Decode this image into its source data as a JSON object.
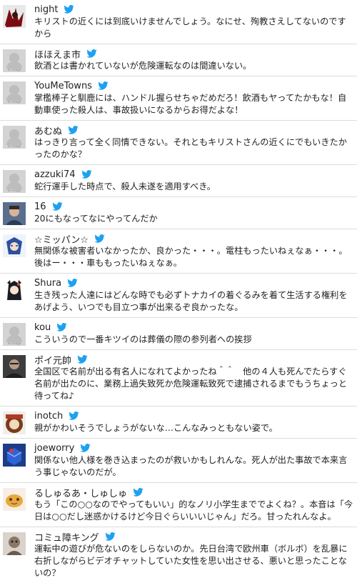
{
  "colors": {
    "twitter_blue": "#1da1f2",
    "divider": "#dcdcdc",
    "text": "#222222"
  },
  "icons": {
    "bird": "twitter-bird-icon",
    "placeholder": "no-image-avatar"
  },
  "tweets": [
    {
      "name": "night",
      "avatar": "photo",
      "text": "キリストの近くには到底いけませんでしょう。なにせ、殉教さえしてないのですから"
    },
    {
      "name": "ほほえま市",
      "avatar": "no image",
      "text": "飲酒とは書かれていないが危険運転なのは間違いない。"
    },
    {
      "name": "YouMeTowns",
      "avatar": "no image",
      "text": "掌檻棒子と馴鹿には、ハンドル握らせちゃだめだろ！飲酒もヤってたかもな！自動車使った殺人は、事故扱いになるからお得だよな！"
    },
    {
      "name": "あむぬ",
      "avatar": "no image",
      "text": "はっきり言って全く同情できない。それともキリストさんの近くにでもいきたかったのかな？"
    },
    {
      "name": "azzuki74",
      "avatar": "no image",
      "text": "蛇行運手した時点で、殺人未遂を適用すべき。"
    },
    {
      "name": "16",
      "avatar": "photo",
      "text": "20にもなってなにやってんだか"
    },
    {
      "name": "☆ミッパン☆",
      "avatar": "photo",
      "text": "無関係な被害者いなかったか、良かった・・・。電柱もったいねぇなぁ・・・。後はー・・・車ももったいねぇなぁ。"
    },
    {
      "name": "Shura",
      "avatar": "photo",
      "text": "生き残った人達にはどんな時でも必ずトナカイの着ぐるみを着て生活する権利をあげよう、いつでも目立つ事が出来るぞ良かったな。"
    },
    {
      "name": "kou",
      "avatar": "no image",
      "text": "こういうので一番キツイのは葬儀の際の参列者への挨拶"
    },
    {
      "name": "ポイ元帥",
      "avatar": "photo",
      "text": "全国区で名前が出る有名人になれてよかったね＾＾　他の４人も死んでたらすぐ名前が出たのに、業務上過失致死か危険運転致死で逮捕されるまでもうちょっと待ってね♪"
    },
    {
      "name": "inotch",
      "avatar": "photo",
      "text": "親がかわいそうでしょうがないな…こんなみっともない姿で。"
    },
    {
      "name": "joeworry",
      "avatar": "photo",
      "text": "関係ない他人様を巻き込まったのが救いかもしれんな。死人が出た事故で本来言う事じゃないのだが。"
    },
    {
      "name": "るしゅるあ・しゅしゅ",
      "avatar": "photo",
      "text": "もう「この○○なのでやってもいい」的なノリ小学生まででよくね？。本音は「今日は○○だし迷惑かけるけど今日ぐらいいいじゃん」だろ。甘ったれんなよ。"
    },
    {
      "name": "コミュ障キング",
      "avatar": "photo",
      "text": "運転中の遊びが危ないのをしらないのか。先日台湾で欧州車（ボルボ）を乱暴に右折しながらビデオチャットしていた女性を思い出させる、悪いと思ったことないの？"
    }
  ]
}
